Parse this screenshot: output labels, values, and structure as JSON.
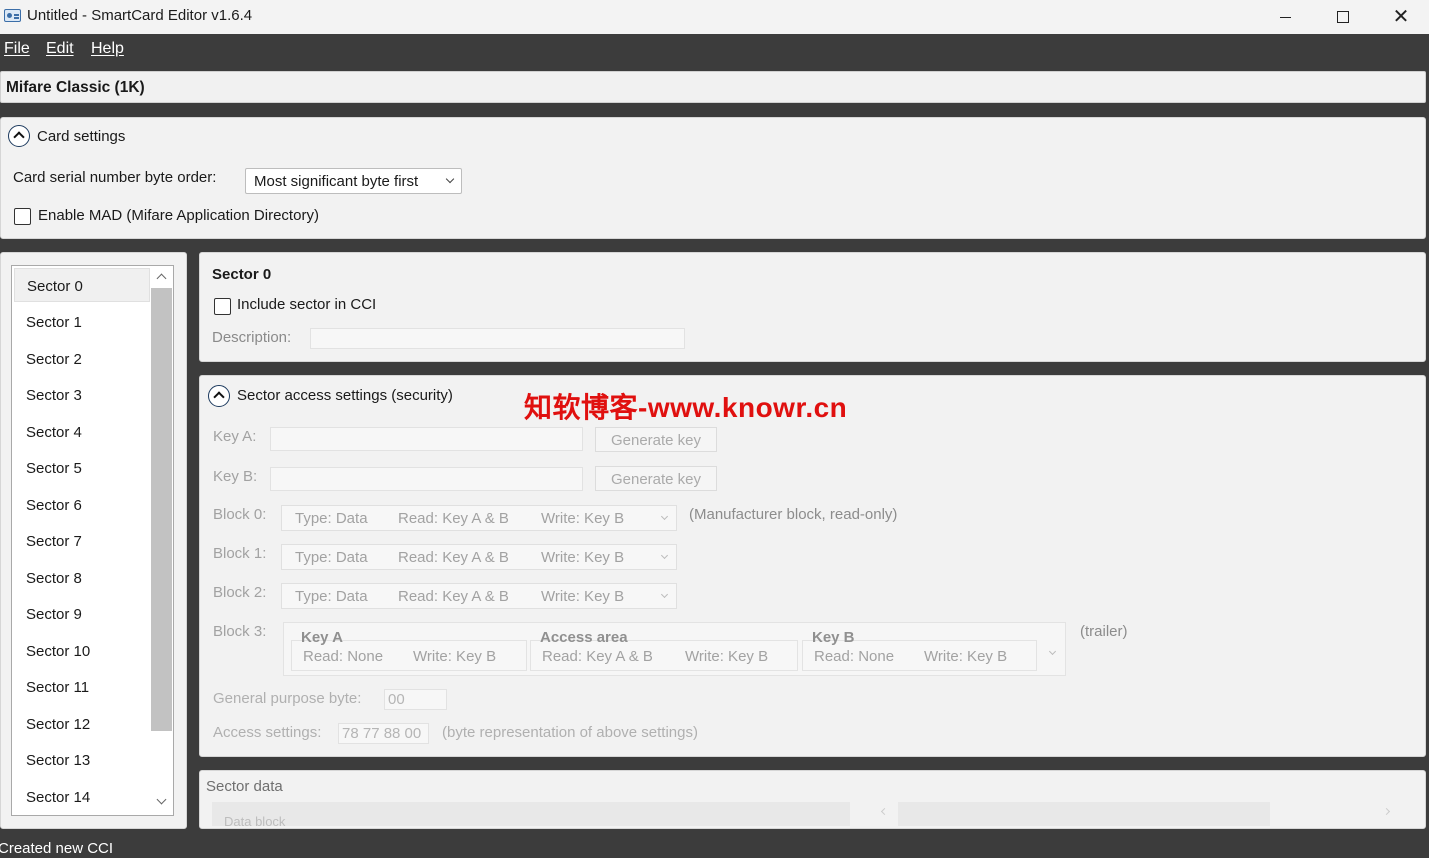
{
  "window": {
    "title": "Untitled - SmartCard Editor v1.6.4",
    "controls": [
      "minimize",
      "maximize",
      "close"
    ]
  },
  "menu": {
    "items": [
      "File",
      "Edit",
      "Help"
    ]
  },
  "card_type": "Mifare Classic (1K)",
  "card_settings": {
    "header": "Card settings",
    "byte_order_label": "Card serial number byte order:",
    "byte_order_value": "Most significant byte first",
    "mad_label": "Enable MAD (Mifare Application Directory)",
    "mad_checked": false
  },
  "sectors": {
    "selected_index": 0,
    "items": [
      "Sector 0",
      "Sector 1",
      "Sector 2",
      "Sector 3",
      "Sector 4",
      "Sector 5",
      "Sector 6",
      "Sector 7",
      "Sector 8",
      "Sector 9",
      "Sector 10",
      "Sector 11",
      "Sector 12",
      "Sector 13",
      "Sector 14"
    ]
  },
  "sector_detail": {
    "title": "Sector 0",
    "include_label": "Include sector in CCI",
    "include_checked": false,
    "description_label": "Description:",
    "description_value": ""
  },
  "access": {
    "header": "Sector access settings (security)",
    "key_a_label": "Key A:",
    "key_b_label": "Key B:",
    "generate_key_label": "Generate key",
    "blocks": [
      {
        "label": "Block 0:",
        "type": "Type: Data",
        "read": "Read: Key A & B",
        "write": "Write: Key B",
        "note": "(Manufacturer block, read-only)"
      },
      {
        "label": "Block 1:",
        "type": "Type: Data",
        "read": "Read: Key A & B",
        "write": "Write: Key B",
        "note": ""
      },
      {
        "label": "Block 2:",
        "type": "Type: Data",
        "read": "Read: Key A & B",
        "write": "Write: Key B",
        "note": ""
      }
    ],
    "block3": {
      "label": "Block 3:",
      "note": "(trailer)",
      "groups": [
        {
          "title": "Key A",
          "read": "Read: None",
          "write": "Write: Key B"
        },
        {
          "title": "Access area",
          "read": "Read: Key A & B",
          "write": "Write: Key B"
        },
        {
          "title": "Key B",
          "read": "Read: None",
          "write": "Write: Key B"
        }
      ]
    },
    "gp_byte_label": "General purpose byte:",
    "gp_byte_value": "00",
    "access_settings_label": "Access settings:",
    "access_settings_value": "78 77 88 00",
    "access_settings_note": "(byte representation of above settings)"
  },
  "sector_data": {
    "header": "Sector data",
    "column_label": "Data block"
  },
  "watermark": "知软博客-www.knowr.cn",
  "status": "Created new CCI"
}
